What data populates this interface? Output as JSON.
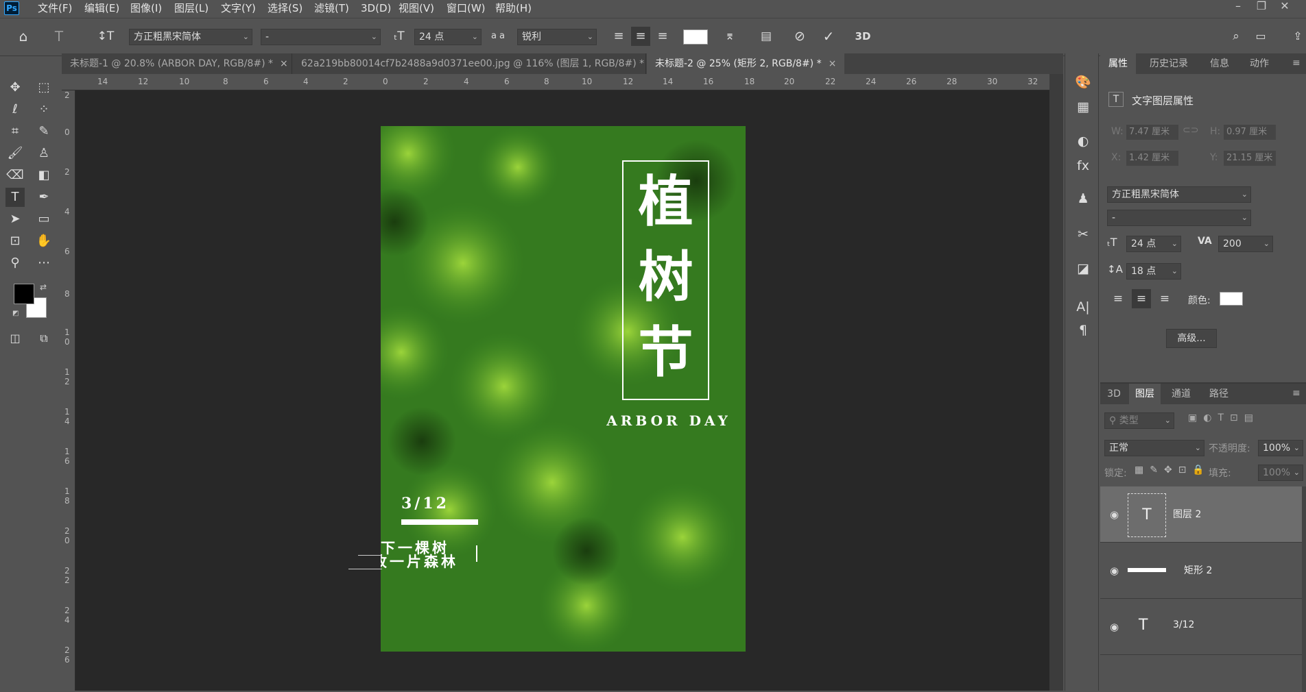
{
  "app": {
    "logo": "Ps"
  },
  "menu": [
    "文件(F)",
    "编辑(E)",
    "图像(I)",
    "图层(L)",
    "文字(Y)",
    "选择(S)",
    "滤镜(T)",
    "3D(D)",
    "视图(V)",
    "窗口(W)",
    "帮助(H)"
  ],
  "options": {
    "font_family": "方正粗黑宋简体",
    "font_style": "-",
    "font_size": "24 点",
    "aa_label": "a a",
    "antialias": "锐利",
    "three_d": "3D"
  },
  "tabs": [
    {
      "label": "未标题-1 @ 20.8% (ARBOR DAY, RGB/8#) *",
      "close": "×"
    },
    {
      "label": "62a219bb80014cf7b2488a9d0371ee00.jpg @ 116% (图层 1, RGB/8#) *",
      "close": "×"
    },
    {
      "label": "未标题-2 @ 25% (矩形 2, RGB/8#) *",
      "close": "×"
    }
  ],
  "ruler_top": [
    "14",
    "12",
    "10",
    "8",
    "6",
    "4",
    "2",
    "0",
    "2",
    "4",
    "6",
    "8",
    "10",
    "12",
    "14",
    "16",
    "18",
    "20",
    "22",
    "24",
    "26",
    "28",
    "30",
    "32"
  ],
  "ruler_left": [
    "2",
    "0",
    "2",
    "4",
    "6",
    "8",
    "1 0",
    "1 2",
    "1 4",
    "1 6",
    "1 8",
    "2 0",
    "2 2",
    "2 4",
    "2 6"
  ],
  "poster": {
    "title_chars": [
      "植",
      "树",
      "节"
    ],
    "subtitle": "ARBOR DAY",
    "date": "3/12",
    "line1": "下一棵树",
    "line2": "收一片森林"
  },
  "properties": {
    "tabs": [
      "属性",
      "历史记录",
      "信息",
      "动作"
    ],
    "header": "文字图层属性",
    "w_label": "W:",
    "w_value": "7.47 厘米",
    "h_label": "H:",
    "h_value": "0.97 厘米",
    "x_label": "X:",
    "x_value": "1.42 厘米",
    "y_label": "Y:",
    "y_value": "21.15 厘米",
    "font_family": "方正粗黑宋简体",
    "font_style": "-",
    "size": "24 点",
    "tracking": "200",
    "leading": "18 点",
    "color_label": "颜色:",
    "color_value": "#ffffff",
    "advanced": "高级..."
  },
  "layers_panel": {
    "tabs": [
      "3D",
      "图层",
      "通道",
      "路径"
    ],
    "filter_placeholder": "类型",
    "blend_mode": "正常",
    "opacity_label": "不透明度:",
    "opacity": "100%",
    "lock_label": "锁定:",
    "fill_label": "填充:",
    "fill": "100%",
    "layers": [
      {
        "name": "图层 2",
        "type": "text",
        "selected": true
      },
      {
        "name": "矩形 2",
        "type": "shape",
        "selected": false
      },
      {
        "name": "3/12",
        "type": "text",
        "selected": false
      }
    ]
  },
  "colors": {
    "foreground": "#000000",
    "background": "#ffffff",
    "ui_dark": "#282828",
    "ui_panel": "#535353"
  }
}
